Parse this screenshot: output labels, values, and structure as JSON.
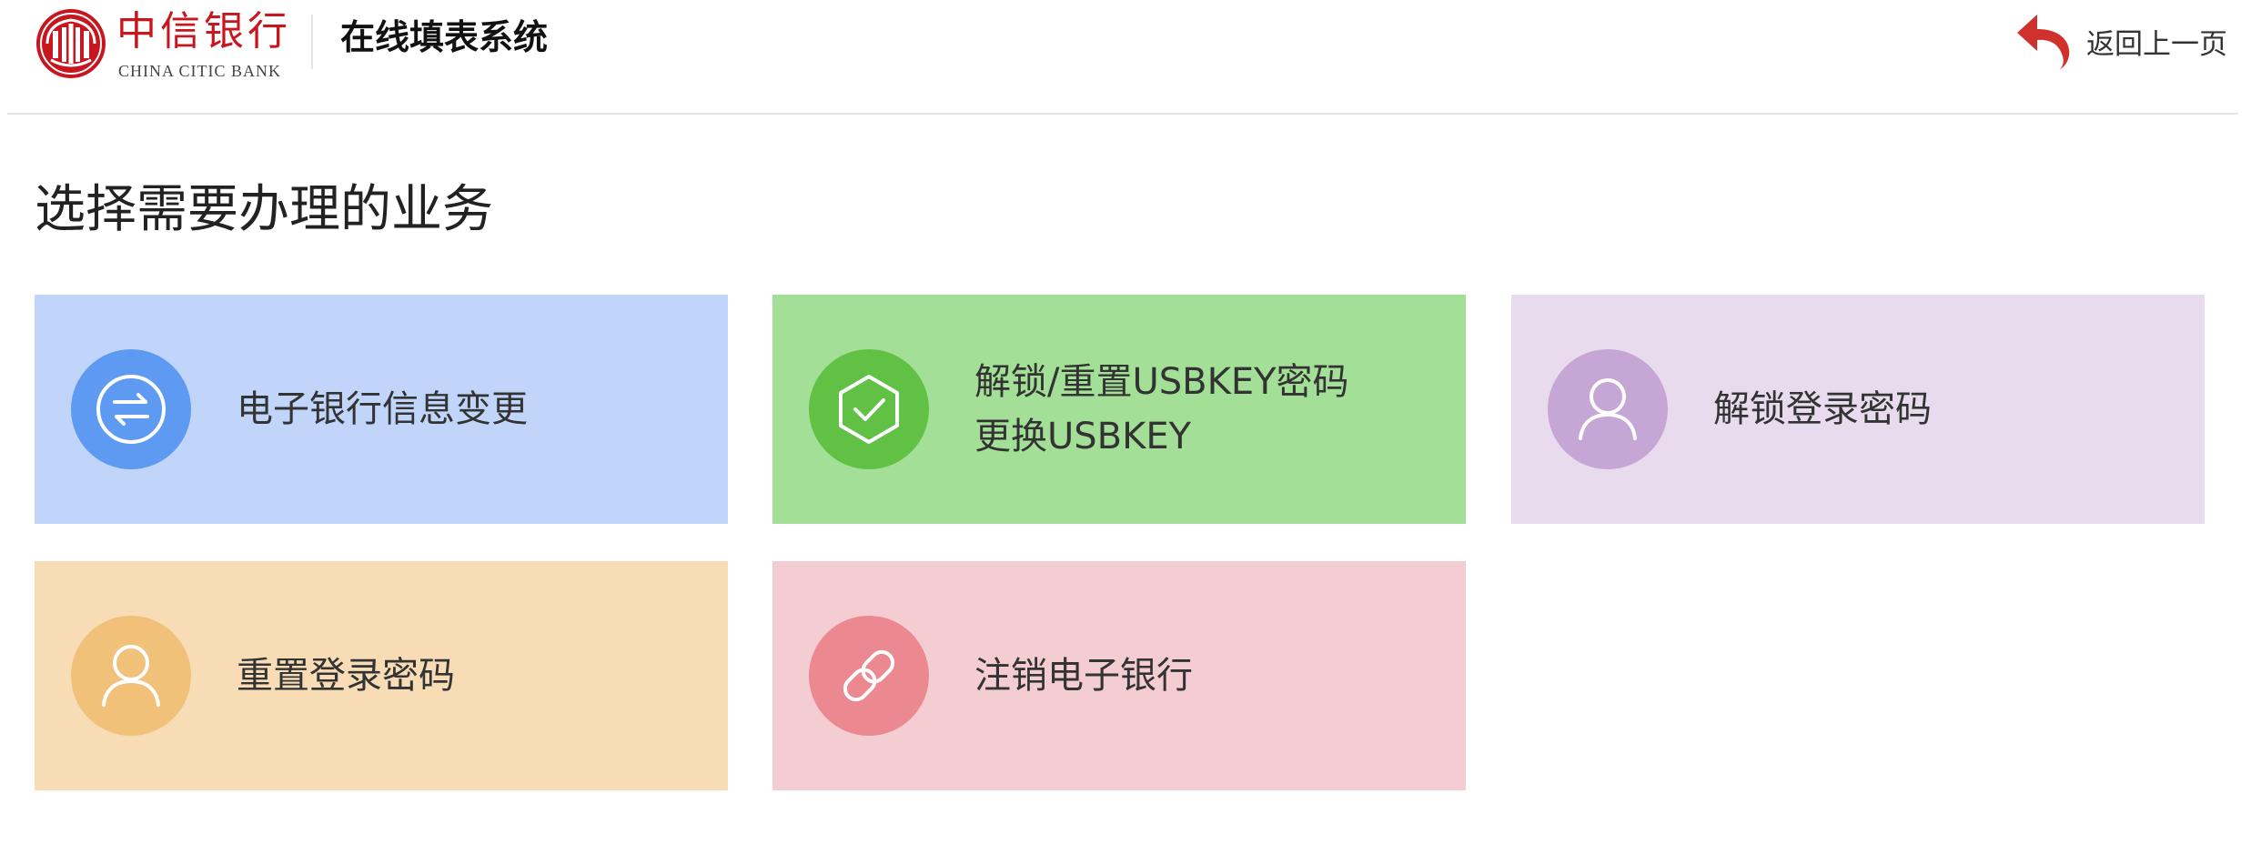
{
  "header": {
    "logo_cn": "中信银行",
    "logo_en": "CHINA CITIC BANK",
    "system_title": "在线填表系统",
    "back_label": "返回上一页"
  },
  "page": {
    "title": "选择需要办理的业务"
  },
  "services": [
    {
      "label": "电子银行信息变更",
      "icon": "exchange-arrows-icon",
      "color": "#5e9af2",
      "bg": "#c1d5fb"
    },
    {
      "label": "解锁/重置USBKEY密码",
      "label_line2": "更换USBKEY",
      "icon": "shield-check-icon",
      "color": "#60c145",
      "bg": "#a3df96"
    },
    {
      "label": "解锁登录密码",
      "icon": "user-icon",
      "color": "#c6a6d4",
      "bg": "#e8dbee"
    },
    {
      "label": "重置登录密码",
      "icon": "user-icon",
      "color": "#f1c17a",
      "bg": "#f7dcb6"
    },
    {
      "label": "注销电子银行",
      "icon": "link-icon",
      "color": "#ec8890",
      "bg": "#f4cdd2"
    }
  ],
  "colors": {
    "brand_red": "#c8161e",
    "divider": "#e5e5e5"
  }
}
